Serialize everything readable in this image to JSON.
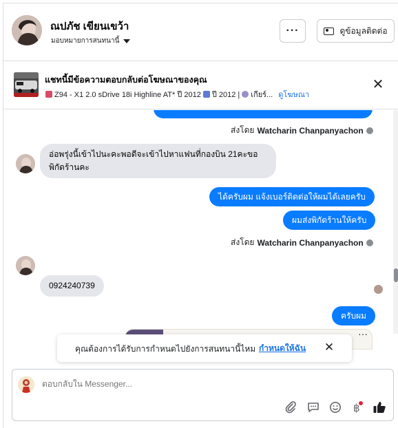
{
  "header": {
    "contact_name": "ณปภัช เขียนเขว้า",
    "assign_label": "มอบหมายการสนทนานี้",
    "more_label": "···",
    "view_contact_label": "ดูข้อมูลติดต่อ"
  },
  "ad_bar": {
    "title": "แชทนี้มีข้อความตอบกลับต่อโฆษณาของคุณ",
    "details": "Z94 - X1 2.0 sDrive 18i Highline AT* ปี 2012",
    "details2": "ปี 2012 |",
    "details3": "เกียร์...",
    "view_ad_link": "ดูโฆษณา",
    "close_label": "✕"
  },
  "chat": {
    "sent_by_prefix": "ส่งโดย",
    "sender_name": "Watcharin Chanpanyachon",
    "messages": [
      {
        "from": "customer",
        "text": "อ่อพรุ่งนี้เข้าไปนะคะพอดีจะเข้าไปหาแฟนที่กองบิน 21คะขอพิกัดร้านคะ"
      },
      {
        "from": "page",
        "text": "ได้ครับผม แจ้งเบอร์ติดต่อให้ผมได้เลยครับ"
      },
      {
        "from": "page",
        "text": "ผมส่งพิกัดร้านให้ครับ"
      },
      {
        "from": "customer",
        "text": "0924240739"
      },
      {
        "from": "page",
        "text": "ครับผม"
      }
    ],
    "peek_dots": "···"
  },
  "reminder": {
    "text": "คุณต้องการได้รับการกำหนดไปยังการสนทนานี้ไหม",
    "link": "กำหนดให้ฉัน",
    "close_label": "✕"
  },
  "composer": {
    "placeholder": "ตอบกลับใน Messenger..."
  },
  "icons": [
    "caret-down-icon",
    "contact-card-icon",
    "close-icon",
    "car-icon",
    "calendar-icon",
    "gear-icon",
    "info-icon",
    "attach-icon",
    "chat-bubble-icon",
    "emoji-icon",
    "currency-icon",
    "thumbs-up-icon"
  ],
  "colors": {
    "accent": "#0a7cff",
    "link": "#1b74e4",
    "incoming_bubble": "#e4e6eb"
  }
}
